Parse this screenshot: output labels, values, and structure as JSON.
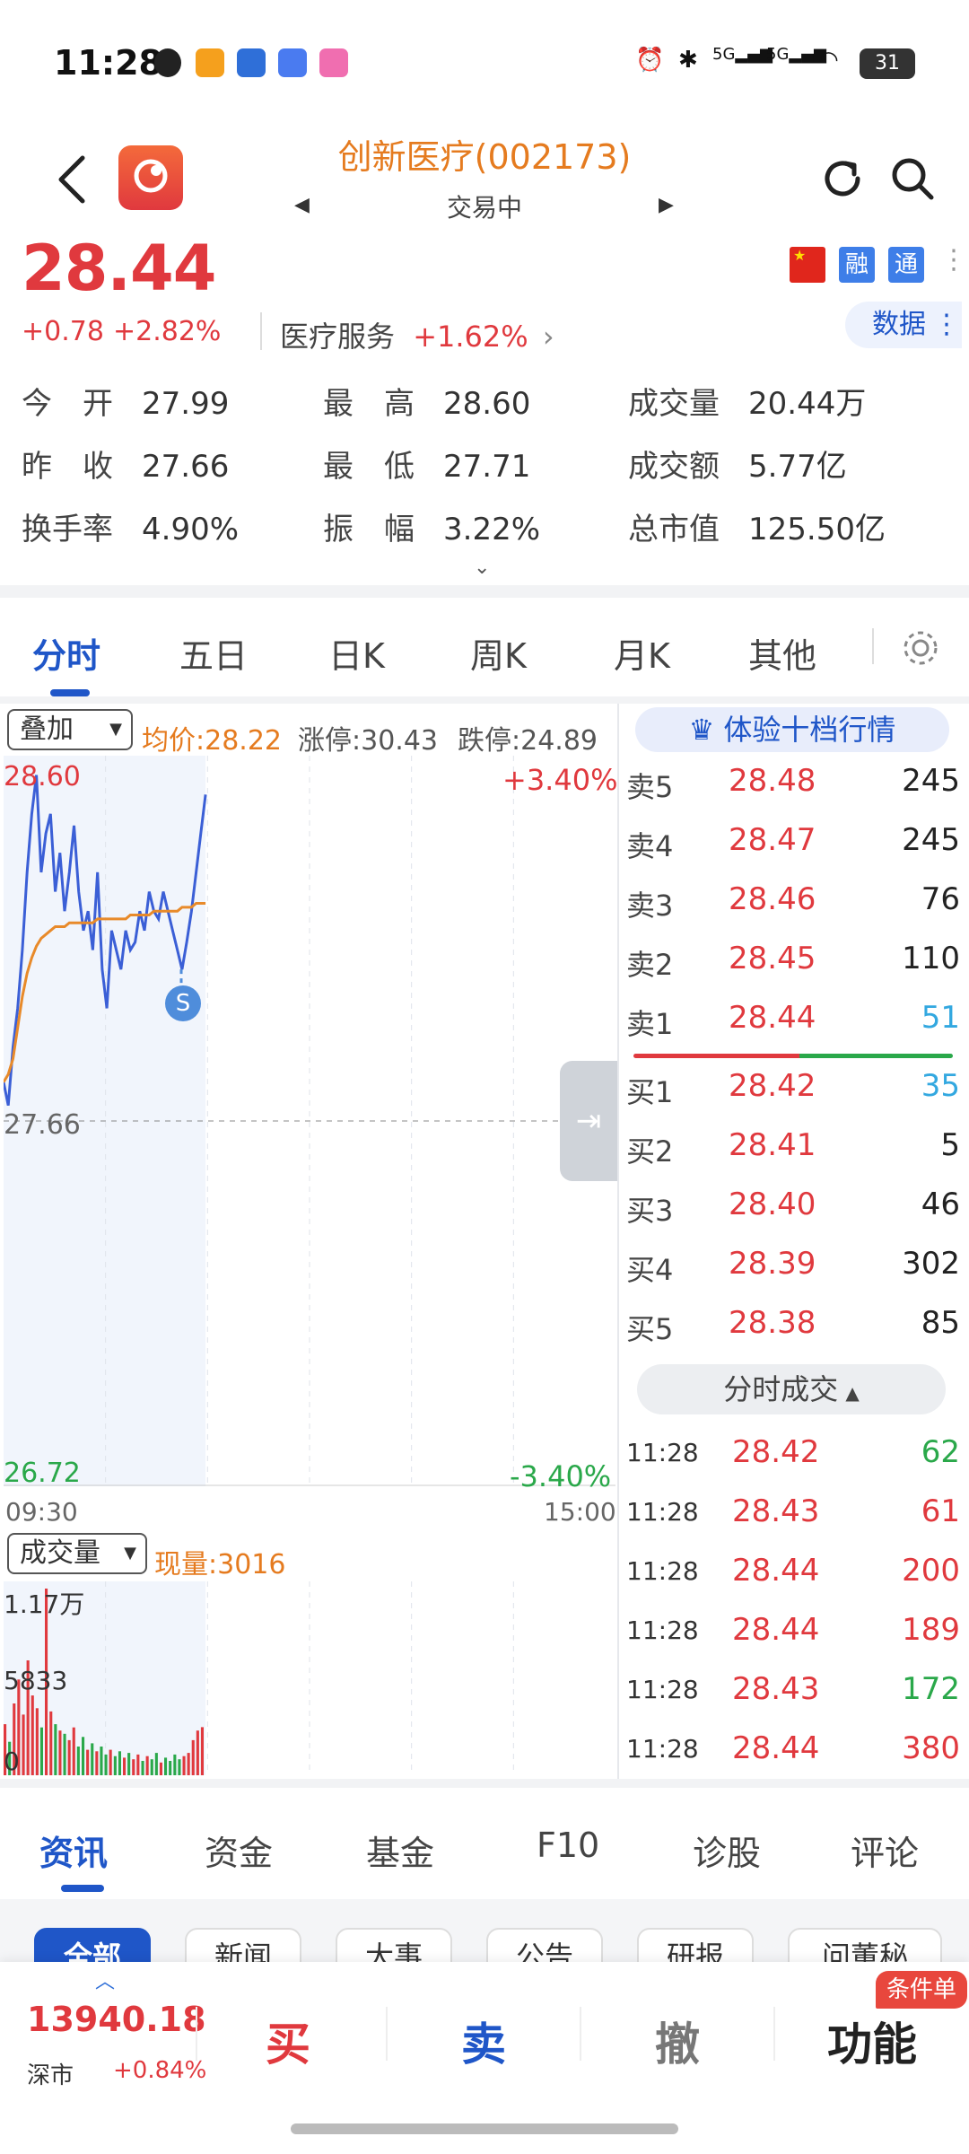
{
  "status_bar": {
    "time": "11:28",
    "battery": "31",
    "network1": "5G",
    "network2": "5G"
  },
  "header": {
    "title": "创新医疗(002173)",
    "status": "交易中"
  },
  "quote": {
    "price": "28.44",
    "change": "+0.78",
    "change_pct": "+2.82%",
    "sector": "医疗服务",
    "sector_pct": "+1.62%",
    "tags": [
      "融",
      "通"
    ],
    "data_btn": "数据"
  },
  "stats": [
    {
      "label": "今　开",
      "value": "27.99"
    },
    {
      "label": "最　高",
      "value": "28.60"
    },
    {
      "label": "成交量",
      "value": "20.44万"
    },
    {
      "label": "昨　收",
      "value": "27.66"
    },
    {
      "label": "最　低",
      "value": "27.71"
    },
    {
      "label": "成交额",
      "value": "5.77亿"
    },
    {
      "label": "换手率",
      "value": "4.90%"
    },
    {
      "label": "振　幅",
      "value": "3.22%"
    },
    {
      "label": "总市值",
      "value": "125.50亿"
    }
  ],
  "chart_tabs": [
    "分时",
    "五日",
    "日K",
    "周K",
    "月K",
    "其他"
  ],
  "chart_header": {
    "overlay": "叠加",
    "avg": "均价:28.22",
    "limit_up": "涨停:30.43",
    "limit_down": "跌停:24.89"
  },
  "chart_labels": {
    "high": "28.60",
    "high_pct": "+3.40%",
    "mid": "27.66",
    "low": "26.72",
    "low_pct": "-3.40%",
    "start_time": "09:30",
    "end_time": "15:00",
    "volume_select": "成交量",
    "current_volume": "现量:3016",
    "vol_max": "1.17万",
    "vol_mid": "5833",
    "vol_zero": "0",
    "marker": "S"
  },
  "chart_data": {
    "type": "line",
    "title": "",
    "xlabel": "",
    "ylabel": "",
    "ylim": [
      26.72,
      28.6
    ],
    "x_range": [
      "09:30",
      "15:00"
    ],
    "series": [
      {
        "name": "",
        "values": [
          27.76,
          27.7,
          27.85,
          27.95,
          28.1,
          28.3,
          28.45,
          28.55,
          28.3,
          28.4,
          28.45,
          28.25,
          28.35,
          28.2,
          28.3,
          28.42,
          28.25,
          28.15,
          28.2,
          28.1,
          28.3,
          28.05,
          27.95,
          28.15,
          28.1,
          28.05,
          28.15,
          28.1,
          28.12,
          28.2,
          28.15,
          28.25,
          28.2,
          28.18,
          28.25,
          28.2,
          28.15,
          28.1,
          28.05,
          28.12,
          28.2,
          28.3,
          28.4,
          28.5
        ]
      },
      {
        "name": "均价",
        "values": [
          27.76,
          27.78,
          27.82,
          27.9,
          27.98,
          28.04,
          28.08,
          28.11,
          28.13,
          28.14,
          28.15,
          28.16,
          28.16,
          28.16,
          28.17,
          28.17,
          28.17,
          28.17,
          28.17,
          28.17,
          28.18,
          28.18,
          28.18,
          28.18,
          28.18,
          28.18,
          28.18,
          28.19,
          28.19,
          28.19,
          28.19,
          28.19,
          28.2,
          28.2,
          28.2,
          28.2,
          28.2,
          28.2,
          28.21,
          28.21,
          28.21,
          28.22,
          28.22,
          28.22
        ]
      }
    ],
    "volume": [
      3200,
      2100,
      4500,
      6000,
      3800,
      7200,
      5000,
      4200,
      3000,
      11700,
      4000,
      3200,
      2800,
      2600,
      2200,
      3000,
      1800,
      2400,
      1600,
      2000,
      1500,
      1800,
      1300,
      1600,
      1200,
      1500,
      1100,
      1400,
      1000,
      1300,
      900,
      1200,
      1000,
      1400,
      800,
      1100,
      900,
      1300,
      1000,
      1200,
      1400,
      2200,
      2800,
      3016
    ]
  },
  "order_book": {
    "button": "体验十档行情",
    "asks": [
      {
        "label": "卖5",
        "price": "28.48",
        "vol": "245"
      },
      {
        "label": "卖4",
        "price": "28.47",
        "vol": "245"
      },
      {
        "label": "卖3",
        "price": "28.46",
        "vol": "76"
      },
      {
        "label": "卖2",
        "price": "28.45",
        "vol": "110"
      },
      {
        "label": "卖1",
        "price": "28.44",
        "vol": "51"
      }
    ],
    "bids": [
      {
        "label": "买1",
        "price": "28.42",
        "vol": "35"
      },
      {
        "label": "买2",
        "price": "28.41",
        "vol": "5"
      },
      {
        "label": "买3",
        "price": "28.40",
        "vol": "46"
      },
      {
        "label": "买4",
        "price": "28.39",
        "vol": "302"
      },
      {
        "label": "买5",
        "price": "28.38",
        "vol": "85"
      }
    ],
    "split_button": "分时成交",
    "ticks": [
      {
        "time": "11:28",
        "price": "28.42",
        "vol": "62",
        "side": "green"
      },
      {
        "time": "11:28",
        "price": "28.43",
        "vol": "61",
        "side": "red"
      },
      {
        "time": "11:28",
        "price": "28.44",
        "vol": "200",
        "side": "red"
      },
      {
        "time": "11:28",
        "price": "28.44",
        "vol": "189",
        "side": "red"
      },
      {
        "time": "11:28",
        "price": "28.43",
        "vol": "172",
        "side": "green"
      },
      {
        "time": "11:28",
        "price": "28.44",
        "vol": "380",
        "side": "red"
      }
    ]
  },
  "news_tabs": [
    "资讯",
    "资金",
    "基金",
    "F10",
    "诊股",
    "评论"
  ],
  "news_chips": [
    "全部",
    "新闻",
    "大事",
    "公告",
    "研报",
    "问董秘"
  ],
  "bottom_bar": {
    "index_value": "13940.18",
    "index_name": "深市",
    "index_pct": "+0.84%",
    "buy": "买",
    "sell": "卖",
    "cancel": "撤",
    "func": "功能",
    "func_badge": "条件单"
  }
}
